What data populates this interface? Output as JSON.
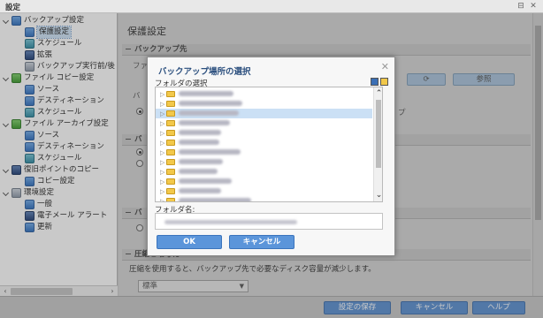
{
  "window": {
    "title": "設定",
    "controls": [
      "⊟",
      "✕"
    ]
  },
  "tree": {
    "items": [
      {
        "label": "バックアップ設定",
        "level": 0,
        "icon": "backup-settings-icon"
      },
      {
        "label": "保護設定",
        "level": 1,
        "icon": "protection-icon",
        "selected": true
      },
      {
        "label": "スケジュール",
        "level": 1,
        "icon": "schedule-icon"
      },
      {
        "label": "拡張",
        "level": 1,
        "icon": "advanced-icon"
      },
      {
        "label": "バックアップ実行前/後",
        "level": 1,
        "icon": "pre-post-icon"
      },
      {
        "label": "ファイル コピー設定",
        "level": 0,
        "icon": "file-copy-icon"
      },
      {
        "label": "ソース",
        "level": 1,
        "icon": "source-icon"
      },
      {
        "label": "デスティネーション",
        "level": 1,
        "icon": "destination-icon"
      },
      {
        "label": "スケジュール",
        "level": 1,
        "icon": "schedule-icon"
      },
      {
        "label": "ファイル アーカイブ設定",
        "level": 0,
        "icon": "file-archive-icon"
      },
      {
        "label": "ソース",
        "level": 1,
        "icon": "source-icon"
      },
      {
        "label": "デスティネーション",
        "level": 1,
        "icon": "destination-icon"
      },
      {
        "label": "スケジュール",
        "level": 1,
        "icon": "schedule-icon"
      },
      {
        "label": "復旧ポイントのコピー",
        "level": 0,
        "icon": "recovery-copy-icon"
      },
      {
        "label": "コピー設定",
        "level": 1,
        "icon": "copy-settings-icon"
      },
      {
        "label": "環境設定",
        "level": 0,
        "icon": "preferences-icon"
      },
      {
        "label": "一般",
        "level": 1,
        "icon": "general-icon"
      },
      {
        "label": "電子メール アラート",
        "level": 1,
        "icon": "email-alert-icon"
      },
      {
        "label": "更新",
        "level": 1,
        "icon": "update-icon"
      }
    ]
  },
  "content": {
    "title": "保護設定",
    "section_destination": "バックアップ先",
    "file_label": "ファ",
    "browse_label": "参照",
    "backup_label": "バ",
    "p_label": "プ",
    "section_2": "バ",
    "section_3": "バ",
    "section_compression": "圧縮と暗号化",
    "compression_desc": "圧縮を使用すると、バックアップ先で必要なディスク容量が減少します。",
    "compression_value": "標準"
  },
  "dialog": {
    "title": "バックアップ場所の選択",
    "folder_select_label": "フォルダの選択",
    "folder_name_label": "フォルダ名:",
    "ok_label": "OK",
    "cancel_label": "キャンセル"
  },
  "bottom": {
    "save_label": "設定の保存",
    "cancel_label": "キャンセル",
    "help_label": "ヘルプ"
  }
}
